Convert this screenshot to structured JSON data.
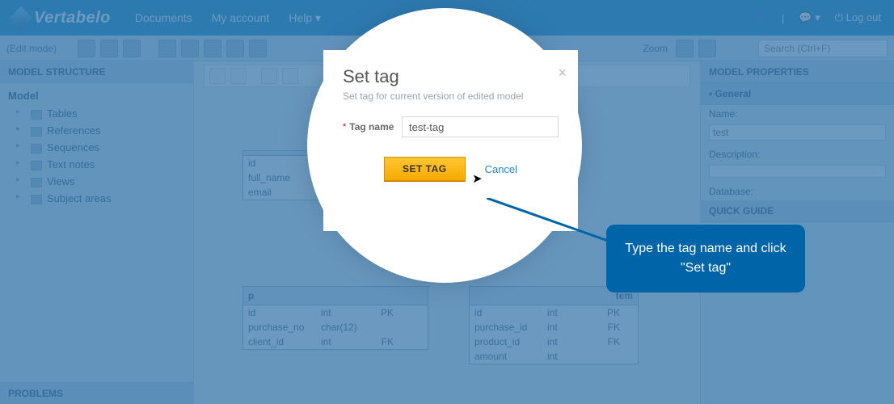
{
  "topnav": {
    "brand": "Vertabelo",
    "links": [
      "Documents",
      "My account",
      "Help ▾"
    ],
    "logout": "Log out"
  },
  "toolbar": {
    "mode": "(Edit mode)",
    "zoom_label": "Zoom",
    "search_placeholder": "Search (Ctrl+F)"
  },
  "left": {
    "head": "MODEL STRUCTURE",
    "root": "Model",
    "items": [
      "Tables",
      "References",
      "Sequences",
      "Text notes",
      "Views",
      "Subject areas"
    ],
    "foot": "PROBLEMS"
  },
  "right": {
    "head": "MODEL PROPERTIES",
    "section": "• General",
    "name_label": "Name:",
    "name_value": "test",
    "desc_label": "Description:",
    "db_label": "Database:",
    "quick": "QUICK GUIDE"
  },
  "tables": {
    "t1": {
      "cols": [
        "id",
        "full_name",
        "email"
      ]
    },
    "t2": {
      "name": "p",
      "rows": [
        {
          "c1": "id",
          "c2": "int",
          "c3": "PK"
        },
        {
          "c1": "purchase_no",
          "c2": "char(12)",
          "c3": ""
        },
        {
          "c1": "client_id",
          "c2": "int",
          "c3": "FK"
        }
      ]
    },
    "t3": {
      "name": "tem",
      "rows": [
        {
          "c1": "id",
          "c2": "int",
          "c3": "PK"
        },
        {
          "c1": "purchase_id",
          "c2": "int",
          "c3": "FK"
        },
        {
          "c1": "product_id",
          "c2": "int",
          "c3": "FK"
        },
        {
          "c1": "amount",
          "c2": "int",
          "c3": ""
        }
      ]
    }
  },
  "modal": {
    "title": "Set tag",
    "subtitle": "Set tag for current version of edited model",
    "field_label": "Tag name",
    "field_value": "test-tag",
    "submit": "SET TAG",
    "cancel": "Cancel"
  },
  "callout": {
    "text": "Type the tag name and click \"Set tag\""
  }
}
